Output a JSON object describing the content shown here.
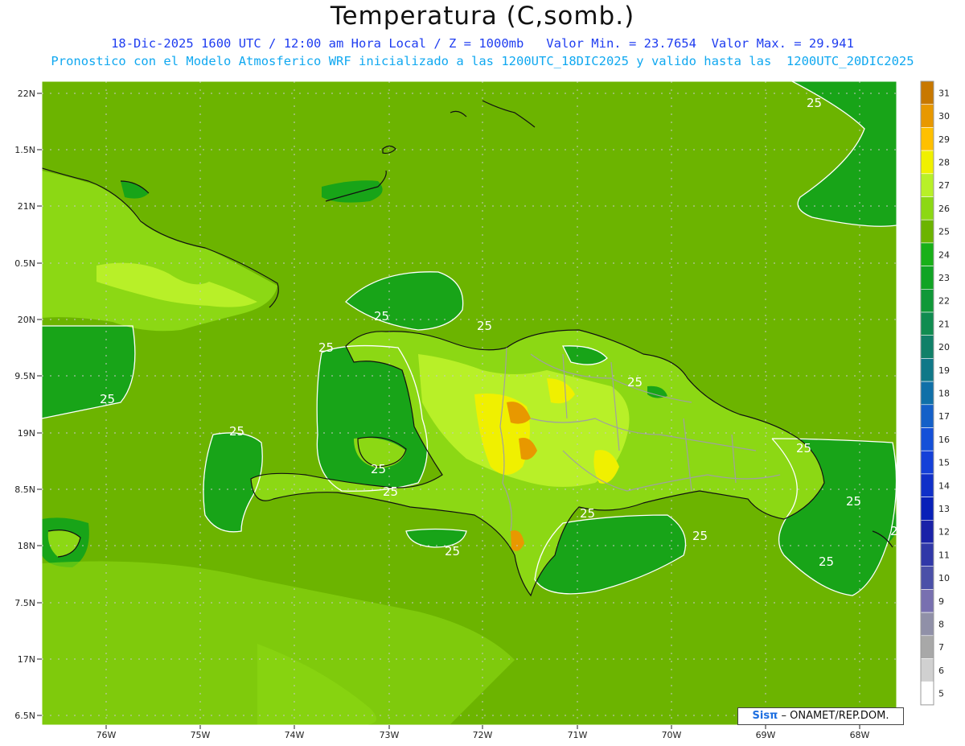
{
  "title": "Temperatura (C,somb.)",
  "subtitle_line1": "18-Dic-2025 1600 UTC / 12:00 am Hora Local / Z = 1000mb   Valor Min. = 23.7654  Valor Max. = 29.941",
  "subtitle_line2": "Pronostico con el Modelo Atmosferico WRF inicializado a las 1200UTC_18DIC2025 y valido hasta las  1200UTC_20DIC2025",
  "map": {
    "lat_labels": [
      "22N",
      "1.5N",
      "21N",
      "0.5N",
      "20N",
      "9.5N",
      "19N",
      "8.5N",
      "18N",
      "7.5N",
      "17N",
      "6.5N"
    ],
    "lon_labels": [
      "76W",
      "75W",
      "74W",
      "73W",
      "72W",
      "71W",
      "70W",
      "69W",
      "68W"
    ],
    "contour_label": "25",
    "contour_label_count": 16
  },
  "colorbar": {
    "levels": [
      "31",
      "30",
      "29",
      "28",
      "27",
      "26",
      "25",
      "24",
      "23",
      "22",
      "21",
      "20",
      "19",
      "18",
      "17",
      "16",
      "15",
      "14",
      "13",
      "12",
      "11",
      "10",
      "9",
      "8",
      "7",
      "6",
      "5"
    ],
    "colors": [
      "#c87800",
      "#e89800",
      "#ffc000",
      "#f0f000",
      "#b8f028",
      "#8cd814",
      "#6cb400",
      "#18b018",
      "#10a424",
      "#109838",
      "#108c50",
      "#108068",
      "#107888",
      "#1070a8",
      "#1460c8",
      "#1450d8",
      "#1440d8",
      "#1030c8",
      "#0820b8",
      "#1a22a8",
      "#3038a8",
      "#4a50a8",
      "#7870b0",
      "#9090a8",
      "#a8a8a8",
      "#d0d0d0",
      "#ffffff"
    ]
  },
  "colors": {
    "ocean_warm": "#6cb400",
    "ocean_cool": "#18a418",
    "land_mid": "#8cd814",
    "land_hot": "#f0f000",
    "land_hottest": "#e89800"
  },
  "credit": {
    "sis": "Sisπ",
    "text": " – ONAMET/REP.DOM."
  }
}
